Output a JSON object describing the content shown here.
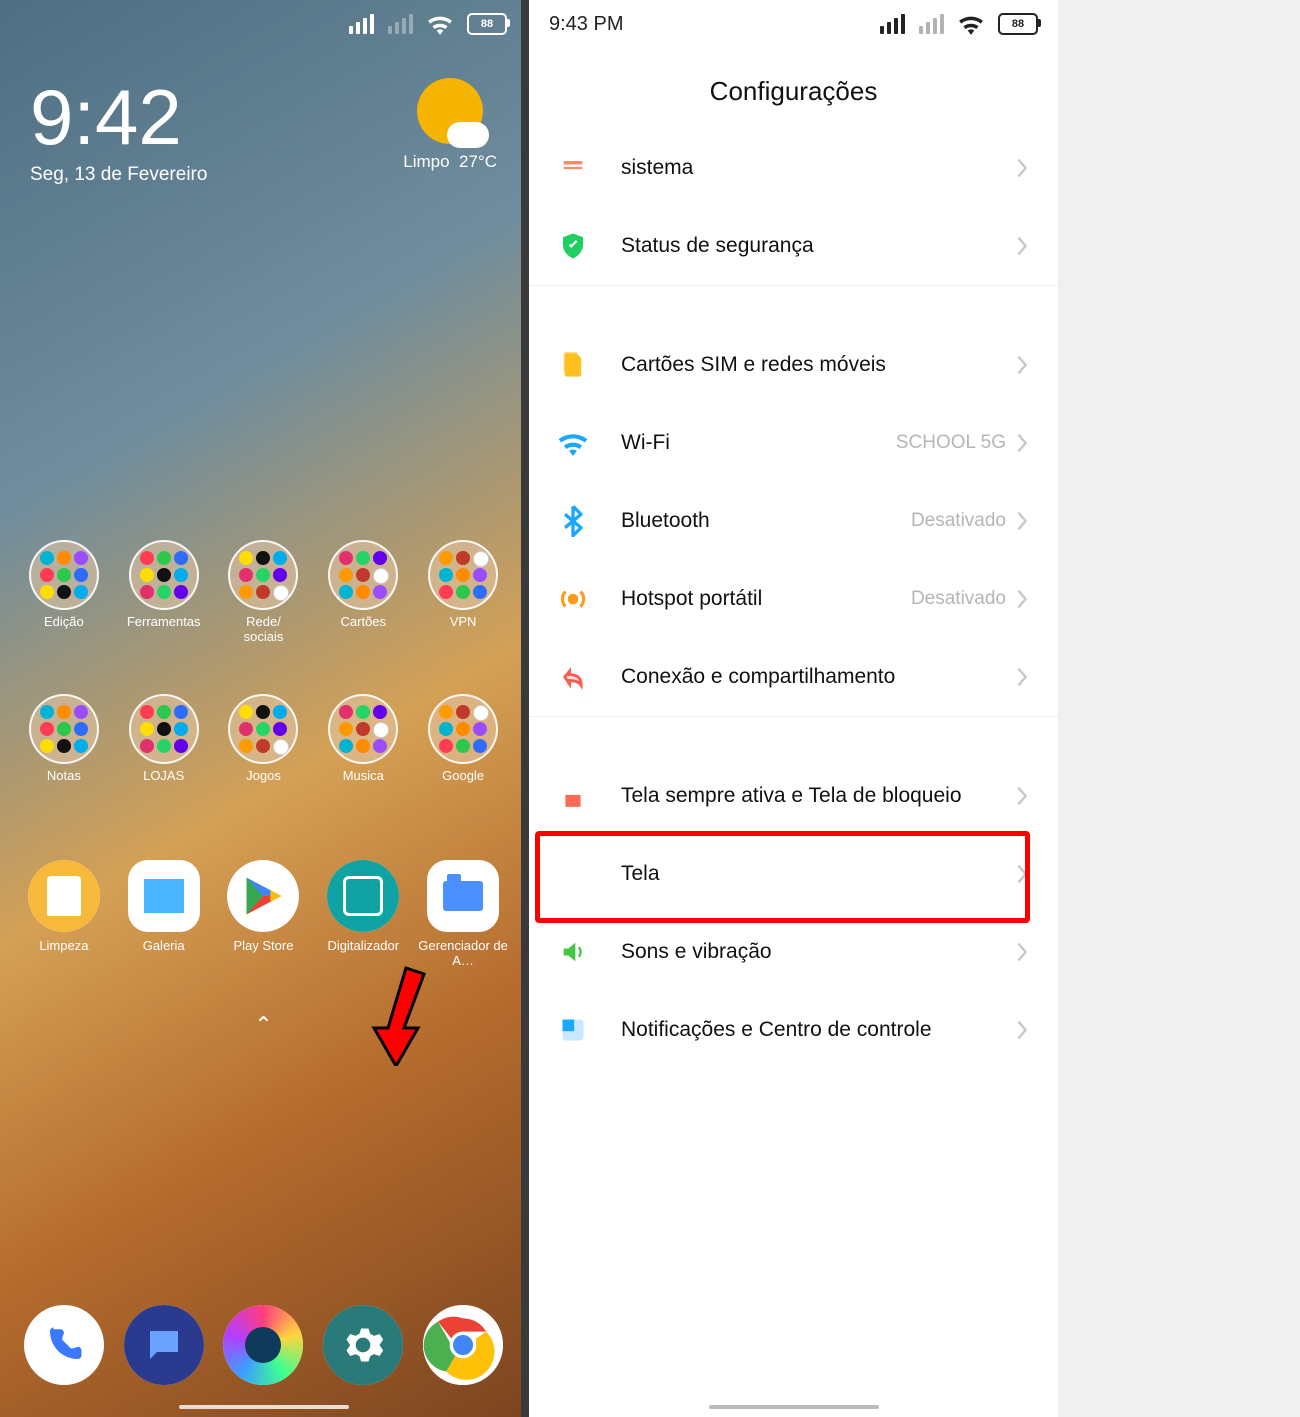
{
  "left": {
    "status": {
      "battery": "88"
    },
    "clock": {
      "time": "9:42",
      "date": "Seg, 13 de Fevereiro"
    },
    "weather": {
      "condition": "Limpo",
      "temp": "27°C"
    },
    "folders_row1": [
      {
        "label": "Edição"
      },
      {
        "label": "Ferramentas"
      },
      {
        "label": "Rede/\nsociais"
      },
      {
        "label": "Cartões"
      },
      {
        "label": "VPN"
      }
    ],
    "folders_row2": [
      {
        "label": "Notas"
      },
      {
        "label": "LOJAS"
      },
      {
        "label": "Jogos"
      },
      {
        "label": "Musica"
      },
      {
        "label": "Google"
      }
    ],
    "apps_row": [
      {
        "label": "Limpeza"
      },
      {
        "label": "Galeria"
      },
      {
        "label": "Play Store"
      },
      {
        "label": "Digitalizador"
      },
      {
        "label": "Gerenciador de A…"
      }
    ],
    "dock": [
      {
        "name": "phone"
      },
      {
        "name": "messages"
      },
      {
        "name": "browser"
      },
      {
        "name": "settings"
      },
      {
        "name": "chrome"
      }
    ]
  },
  "right": {
    "status": {
      "time": "9:43 PM",
      "battery": "88"
    },
    "title": "Configurações",
    "rows": [
      {
        "icon": "system",
        "color": "#ff8b66",
        "label": "sistema",
        "value": ""
      },
      {
        "icon": "shield",
        "color": "#1fcf63",
        "label": "Status de segurança",
        "value": ""
      },
      {
        "sep": true
      },
      {
        "icon": "sim",
        "color": "#ffbf20",
        "label": "Cartões SIM e redes móveis",
        "value": ""
      },
      {
        "icon": "wifi",
        "color": "#1aa8ff",
        "label": "Wi-Fi",
        "value": "SCHOOL 5G"
      },
      {
        "icon": "bt",
        "color": "#1aa8ff",
        "label": "Bluetooth",
        "value": "Desativado"
      },
      {
        "icon": "hotspot",
        "color": "#ff9a1a",
        "label": "Hotspot portátil",
        "value": "Desativado"
      },
      {
        "icon": "share",
        "color": "#ff5a4d",
        "label": "Conexão e compartilhamento",
        "value": ""
      },
      {
        "sep": true
      },
      {
        "icon": "lock",
        "color": "#ff6a55",
        "label": "Tela sempre ativa e Tela de bloqueio",
        "value": ""
      },
      {
        "icon": "sun",
        "color": "#ffba1a",
        "label": "Tela",
        "value": "",
        "highlight": true
      },
      {
        "icon": "sound",
        "color": "#42c746",
        "label": "Sons e vibração",
        "value": ""
      },
      {
        "icon": "notif",
        "color": "#1aa8ff",
        "label": "Notificações e Centro de controle",
        "value": ""
      }
    ]
  }
}
